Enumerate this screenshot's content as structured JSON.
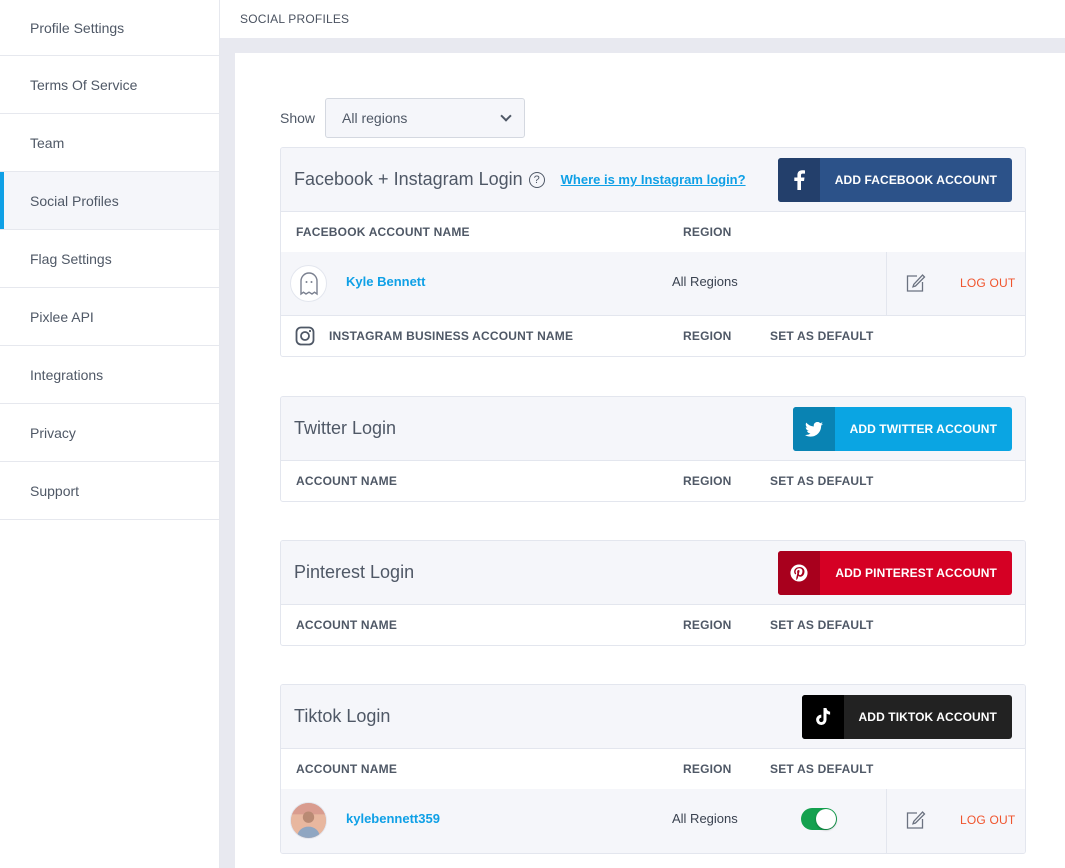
{
  "sidebar": {
    "items": [
      {
        "label": "Profile Settings",
        "active": false
      },
      {
        "label": "Terms Of Service",
        "active": false
      },
      {
        "label": "Team",
        "active": false
      },
      {
        "label": "Social Profiles",
        "active": true
      },
      {
        "label": "Flag Settings",
        "active": false
      },
      {
        "label": "Pixlee API",
        "active": false
      },
      {
        "label": "Integrations",
        "active": false
      },
      {
        "label": "Privacy",
        "active": false
      },
      {
        "label": "Support",
        "active": false
      }
    ]
  },
  "header": {
    "title": "SOCIAL PROFILES"
  },
  "filter": {
    "label": "Show",
    "selected": "All regions"
  },
  "facebook": {
    "title": "Facebook + Instagram Login",
    "help_link": "Where is my Instagram login?",
    "add_button": "ADD FACEBOOK ACCOUNT",
    "col_name": "FACEBOOK ACCOUNT NAME",
    "col_region": "REGION",
    "account": {
      "name": "Kyle Bennett",
      "region": "All Regions",
      "logout": "LOG OUT"
    },
    "ig_col_name": "INSTAGRAM BUSINESS ACCOUNT NAME",
    "ig_col_region": "REGION",
    "ig_col_default": "SET AS DEFAULT"
  },
  "twitter": {
    "title": "Twitter Login",
    "add_button": "ADD TWITTER ACCOUNT",
    "col_name": "ACCOUNT NAME",
    "col_region": "REGION",
    "col_default": "SET AS DEFAULT"
  },
  "pinterest": {
    "title": "Pinterest Login",
    "add_button": "ADD PINTEREST ACCOUNT",
    "col_name": "ACCOUNT NAME",
    "col_region": "REGION",
    "col_default": "SET AS DEFAULT"
  },
  "tiktok": {
    "title": "Tiktok Login",
    "add_button": "ADD TIKTOK ACCOUNT",
    "col_name": "ACCOUNT NAME",
    "col_region": "REGION",
    "col_default": "SET AS DEFAULT",
    "account": {
      "name": "kylebennett359",
      "region": "All Regions",
      "is_default": true,
      "logout": "LOG OUT"
    }
  },
  "colors": {
    "accent": "#0fa0e6",
    "facebook": "#2c5289",
    "twitter": "#0aa5e3",
    "pinterest": "#d50024",
    "tiktok": "#222222",
    "logout": "#f0542d",
    "toggle_on": "#14a14f"
  }
}
